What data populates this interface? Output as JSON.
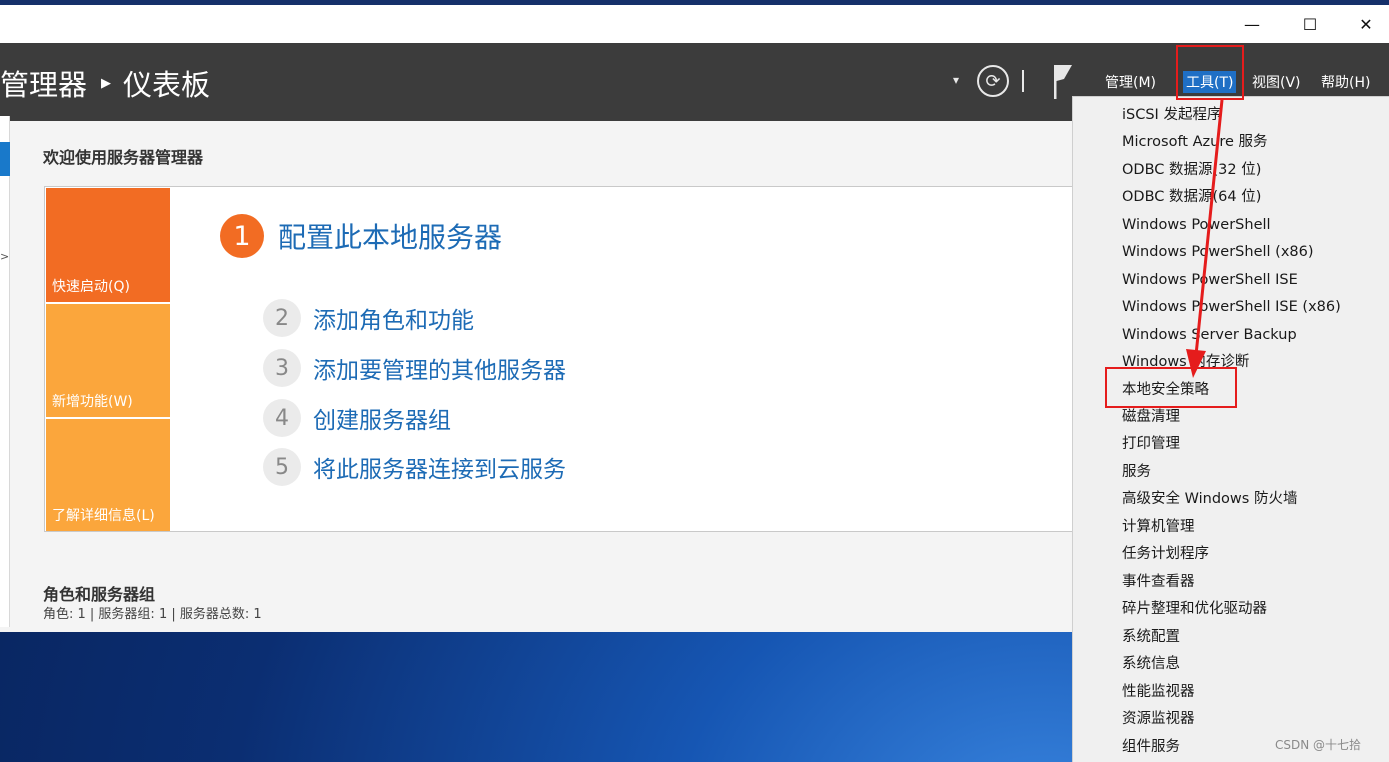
{
  "window": {
    "controls": {
      "minimize": "—",
      "maximize": "☐",
      "close": "✕"
    }
  },
  "header": {
    "breadcrumb_app": "管理器",
    "breadcrumb_sep": "▶",
    "breadcrumb_page": "仪表板",
    "dropdown_icon": "▾",
    "refresh_icon": "⟳",
    "divider": "|",
    "menus": {
      "manage": "管理(M)",
      "tools": "工具(T)",
      "view": "视图(V)",
      "help": "帮助(H)"
    }
  },
  "leftnav": {
    "expand_icon": ">"
  },
  "welcome": {
    "title": "欢迎使用服务器管理器",
    "tiles": [
      "快速启动(Q)",
      "新增功能(W)",
      "了解详细信息(L)"
    ],
    "steps": [
      {
        "num": "1",
        "label": "配置此本地服务器"
      },
      {
        "num": "2",
        "label": "添加角色和功能"
      },
      {
        "num": "3",
        "label": "添加要管理的其他服务器"
      },
      {
        "num": "4",
        "label": "创建服务器组"
      },
      {
        "num": "5",
        "label": "将此服务器连接到云服务"
      }
    ]
  },
  "roles": {
    "title": "角色和服务器组",
    "summary": "角色: 1 | 服务器组: 1 | 服务器总数: 1"
  },
  "tools_menu": {
    "items": [
      "iSCSI 发起程序",
      "Microsoft Azure 服务",
      "ODBC 数据源(32 位)",
      "ODBC 数据源(64 位)",
      "Windows PowerShell",
      "Windows PowerShell (x86)",
      "Windows PowerShell ISE",
      "Windows PowerShell ISE (x86)",
      "Windows Server Backup",
      "Windows 内存诊断",
      "本地安全策略",
      "磁盘清理",
      "打印管理",
      "服务",
      "高级安全 Windows 防火墙",
      "计算机管理",
      "任务计划程序",
      "事件查看器",
      "碎片整理和优化驱动器",
      "系统配置",
      "系统信息",
      "性能监视器",
      "资源监视器",
      "组件服务"
    ]
  },
  "watermark": "CSDN @十七拾",
  "colors": {
    "accent": "#1f6fc5",
    "highlight_red": "#e51c1c",
    "tile_orange": "#f26c23",
    "tile_light_orange": "#fba63c",
    "link_blue": "#1d6bb5"
  }
}
